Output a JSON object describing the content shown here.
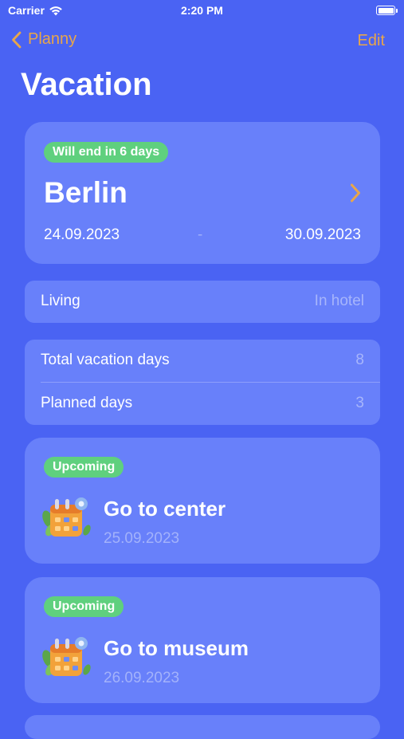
{
  "status_bar": {
    "carrier": "Carrier",
    "time": "2:20 PM"
  },
  "nav": {
    "back_label": "Planny",
    "edit_label": "Edit"
  },
  "page": {
    "title": "Vacation"
  },
  "vacation": {
    "badge": "Will end in 6 days",
    "city": "Berlin",
    "start_date": "24.09.2023",
    "separator": "-",
    "end_date": "30.09.2023"
  },
  "living": {
    "label": "Living",
    "value": "In hotel"
  },
  "stats": [
    {
      "label": "Total vacation days",
      "value": "8"
    },
    {
      "label": "Planned days",
      "value": "3"
    }
  ],
  "events": [
    {
      "badge": "Upcoming",
      "title": "Go to center",
      "date": "25.09.2023",
      "icon": "calendar-icon"
    },
    {
      "badge": "Upcoming",
      "title": "Go to museum",
      "date": "26.09.2023",
      "icon": "calendar-icon"
    }
  ],
  "colors": {
    "background": "#4a63f3",
    "card": "#6880fa",
    "accent": "#e8a64a",
    "badge_green": "#5fd07e",
    "secondary_text": "#a7b5fb"
  }
}
